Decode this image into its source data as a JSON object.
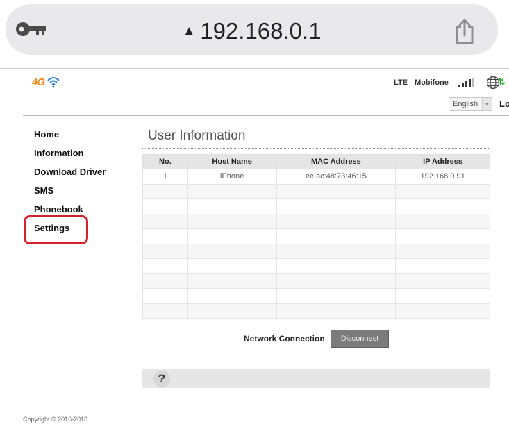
{
  "browser": {
    "url": "192.168.0.1",
    "icons": {
      "left": "key-icon",
      "warning": "warning-icon",
      "share": "share-icon"
    }
  },
  "header": {
    "logo_text": "4G",
    "network_type": "LTE",
    "operator": "Mobifone",
    "language": "English",
    "logout_label": "Lo",
    "colors": {
      "logo": "#f08c1e",
      "wifi": "#2a7fd4",
      "arrows": "#2eaa3a"
    }
  },
  "sidebar": {
    "items": [
      {
        "label": "Home"
      },
      {
        "label": "Information"
      },
      {
        "label": "Download Driver"
      },
      {
        "label": "SMS"
      },
      {
        "label": "Phonebook"
      },
      {
        "label": "Settings"
      }
    ],
    "highlight_color": "#d2232a"
  },
  "main": {
    "title": "User Information",
    "table": {
      "columns": [
        "No.",
        "Host Name",
        "MAC Address",
        "IP Address"
      ],
      "rows": [
        [
          "1",
          "iPhone",
          "ee:ac:48:73:46:15",
          "192.168.0.91"
        ],
        [
          "",
          "",
          "",
          ""
        ],
        [
          "",
          "",
          "",
          ""
        ],
        [
          "",
          "",
          "",
          ""
        ],
        [
          "",
          "",
          "",
          ""
        ],
        [
          "",
          "",
          "",
          ""
        ],
        [
          "",
          "",
          "",
          ""
        ],
        [
          "",
          "",
          "",
          ""
        ],
        [
          "",
          "",
          "",
          ""
        ],
        [
          "",
          "",
          "",
          ""
        ]
      ]
    },
    "network_connection_label": "Network Connection",
    "disconnect_label": "Disconnect",
    "help_label": "?"
  },
  "footer": {
    "copyright": "Copyright © 2016-2018"
  }
}
